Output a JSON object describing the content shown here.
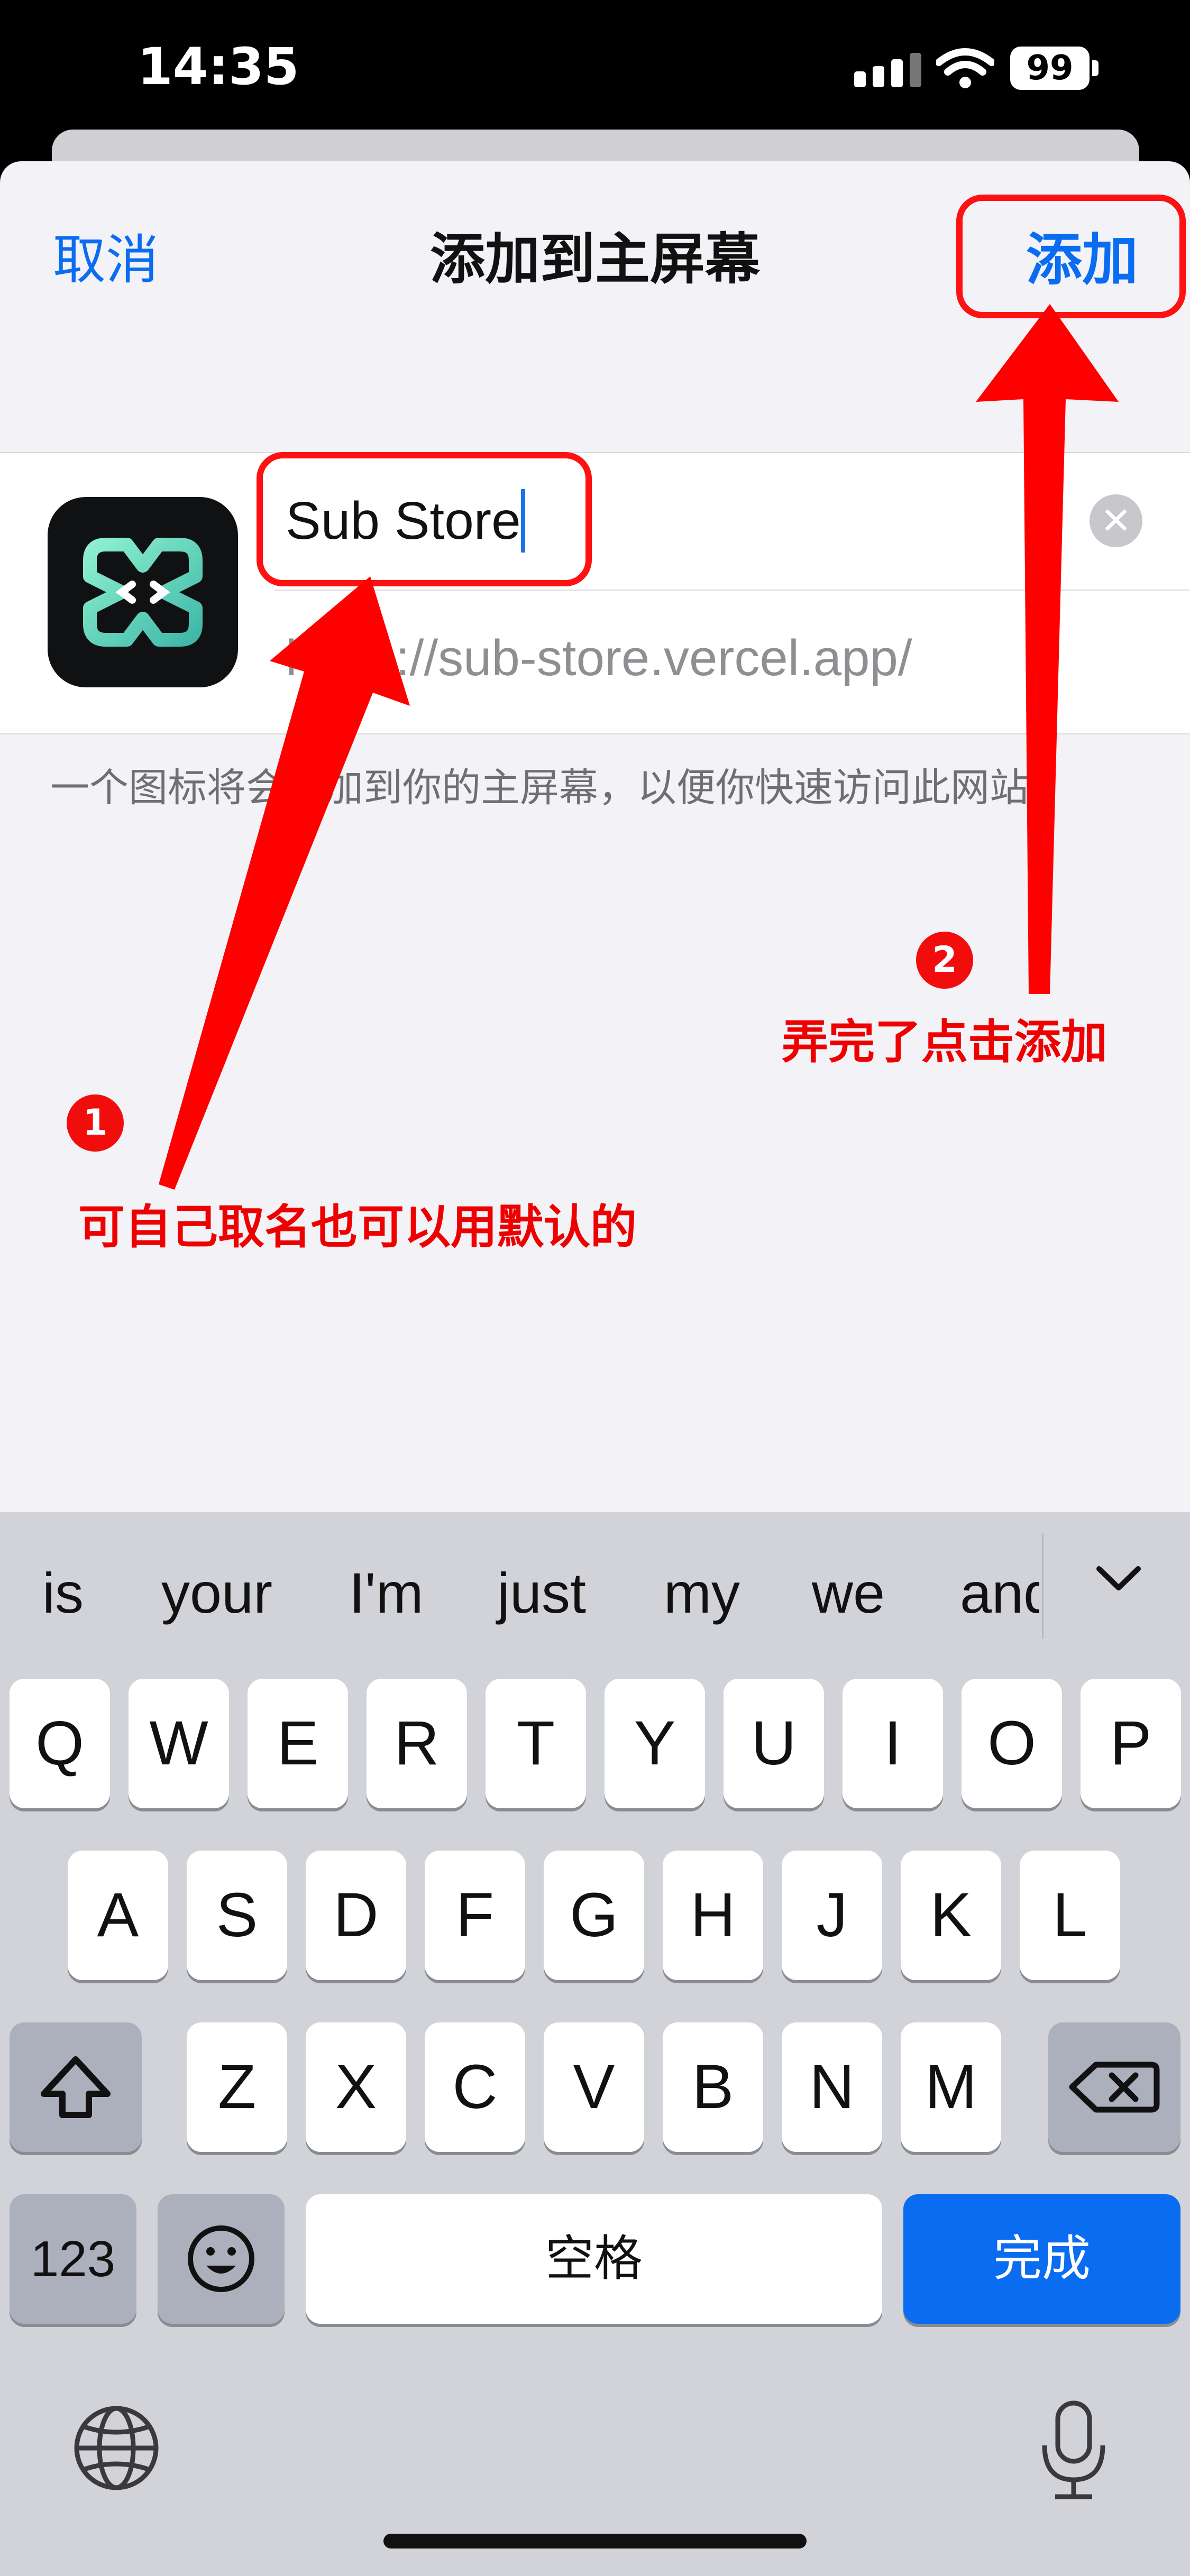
{
  "status": {
    "time": "14:35",
    "battery": "99"
  },
  "nav": {
    "cancel": "取消",
    "title": "添加到主屏幕",
    "add": "添加"
  },
  "form": {
    "name_value": "Sub Store",
    "url": "https://sub-store.vercel.app/",
    "footnote": "一个图标将会添加到你的主屏幕，以便你快速访问此网站。"
  },
  "annotations": {
    "badge1": "1",
    "text1": "可自己取名也可以用默认的",
    "badge2": "2",
    "text2": "弄完了点击添加",
    "color": "#ff1111"
  },
  "keyboard": {
    "suggestions": [
      "is",
      "your",
      "I'm",
      "just",
      "my",
      "we",
      "and"
    ],
    "row1": [
      "Q",
      "W",
      "E",
      "R",
      "T",
      "Y",
      "U",
      "I",
      "O",
      "P"
    ],
    "row2": [
      "A",
      "S",
      "D",
      "F",
      "G",
      "H",
      "J",
      "K",
      "L"
    ],
    "row3": [
      "Z",
      "X",
      "C",
      "V",
      "B",
      "N",
      "M"
    ],
    "numbers": "123",
    "space": "空格",
    "done": "完成",
    "shift_icon": "shift-icon",
    "delete_icon": "delete-icon",
    "emoji_icon": "emoji-icon",
    "globe_icon": "globe-icon",
    "mic_icon": "mic-icon"
  },
  "colors": {
    "accent": "#0a6cf0",
    "sheet": "#f2f2f7",
    "keyboard": "#d1d3d9"
  }
}
